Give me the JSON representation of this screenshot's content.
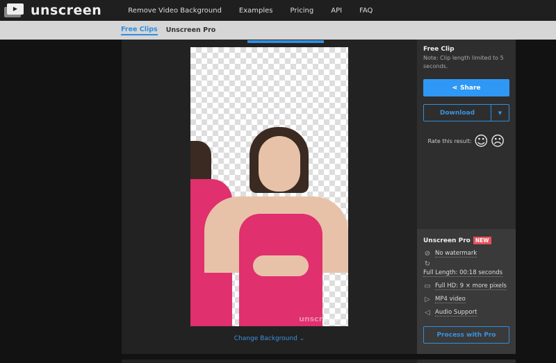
{
  "header": {
    "brand": "unscreen",
    "nav": [
      "Remove Video Background",
      "Examples",
      "Pricing",
      "API",
      "FAQ"
    ]
  },
  "subnav": {
    "tabs": [
      "Free Clips",
      "Unscreen Pro"
    ],
    "active": "Free Clips"
  },
  "preview": {
    "watermark": "unscreen",
    "change_background": "Change Background"
  },
  "sidebar": {
    "title": "Free Clip",
    "note": "Note: Clip length limited to 5 seconds.",
    "share": "Share",
    "download": "Download",
    "rate": "Rate this result:"
  },
  "pro": {
    "title": "Unscreen Pro",
    "badge": "NEW",
    "features": [
      {
        "icon": "no-watermark-icon",
        "label": "No watermark"
      },
      {
        "icon": "clock-icon",
        "label": "Full Length: 00:18 seconds"
      },
      {
        "icon": "monitor-icon",
        "label": "Full HD: 9 × more pixels"
      },
      {
        "icon": "video-icon",
        "label": "MP4 video"
      },
      {
        "icon": "speaker-icon",
        "label": "Audio Support"
      }
    ],
    "button": "Process with Pro"
  },
  "colors": {
    "accent": "#2f98f5",
    "badge": "#e8505b"
  }
}
